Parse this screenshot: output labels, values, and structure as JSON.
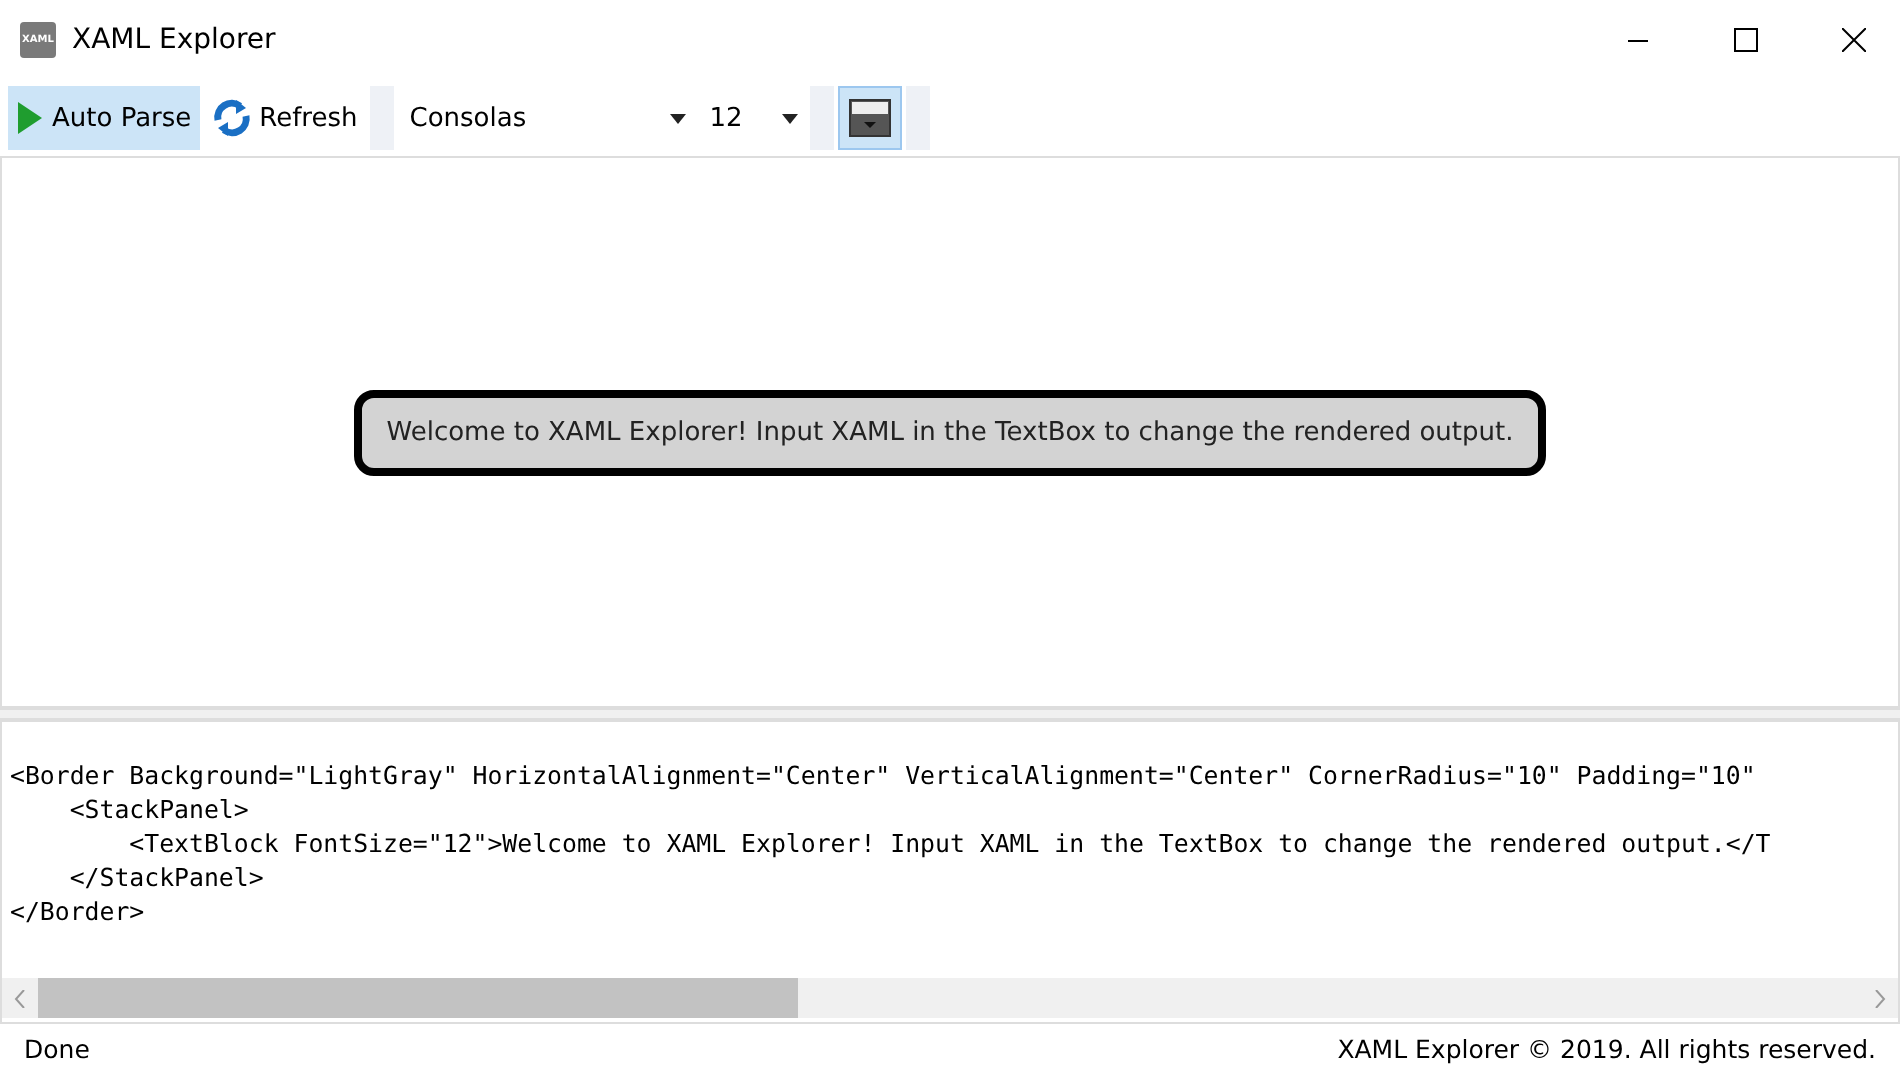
{
  "window": {
    "title": "XAML Explorer",
    "app_icon_label": "XAML"
  },
  "toolbar": {
    "items": [
      {
        "kind": "toggle",
        "label": "Auto Parse",
        "selected": true
      },
      {
        "kind": "button",
        "label": "Refresh",
        "selected": false
      },
      {
        "kind": "grip"
      },
      {
        "kind": "combo",
        "value": "Consolas"
      },
      {
        "kind": "combo",
        "value": "12"
      },
      {
        "kind": "grip"
      },
      {
        "kind": "icon-toggle",
        "selected": true
      },
      {
        "kind": "grip"
      }
    ]
  },
  "preview": {
    "message": "Welcome to XAML Explorer! Input XAML in the TextBox to change the rendered output."
  },
  "editor": {
    "lines": [
      "<Border Background=\"LightGray\" HorizontalAlignment=\"Center\" VerticalAlignment=\"Center\" CornerRadius=\"10\" Padding=\"10\"",
      "    <StackPanel>",
      "        <TextBlock FontSize=\"12\">Welcome to XAML Explorer! Input XAML in the TextBox to change the rendered output.</T",
      "    </StackPanel>",
      "</Border>"
    ]
  },
  "status_bar": {
    "left": "Done",
    "right": "XAML Explorer © 2019. All rights reserved."
  }
}
